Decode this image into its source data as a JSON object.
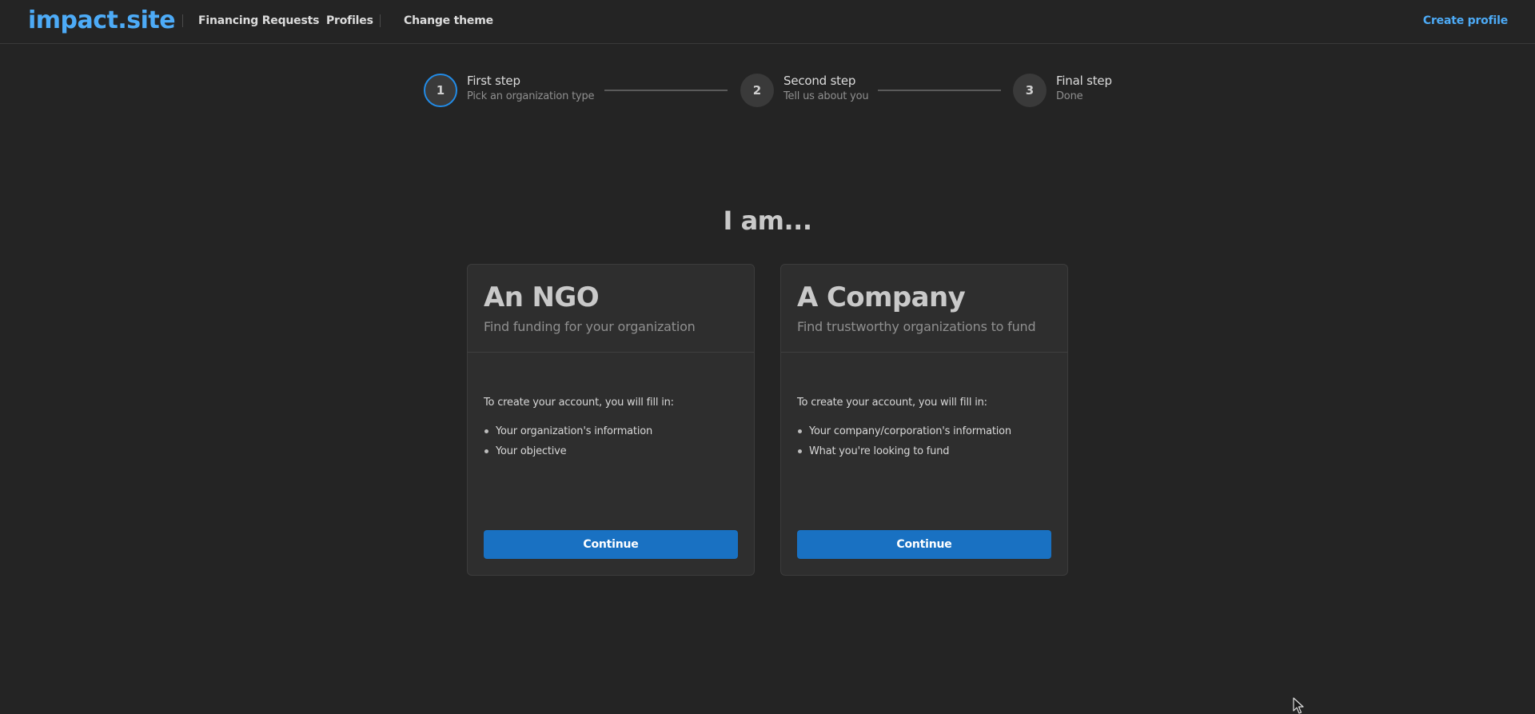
{
  "header": {
    "logo": "impact.site",
    "nav": [
      {
        "label": "Financing Requests"
      },
      {
        "label": "Profiles"
      },
      {
        "label": "Change theme"
      }
    ],
    "create_profile": "Create profile"
  },
  "stepper": {
    "steps": [
      {
        "number": "1",
        "title": "First step",
        "description": "Pick an organization type",
        "active": true
      },
      {
        "number": "2",
        "title": "Second step",
        "description": "Tell us about you",
        "active": false
      },
      {
        "number": "3",
        "title": "Final step",
        "description": "Done",
        "active": false
      }
    ]
  },
  "main": {
    "heading": "I am...",
    "cards": [
      {
        "title": "An NGO",
        "subtitle": "Find funding for your organization",
        "intro": "To create your account, you will fill in:",
        "items": [
          "Your organization's information",
          "Your objective"
        ],
        "button": "Continue"
      },
      {
        "title": "A Company",
        "subtitle": "Find trustworthy organizations to fund",
        "intro": "To create your account, you will fill in:",
        "items": [
          "Your company/corporation's information",
          "What you're looking to fund"
        ],
        "button": "Continue"
      }
    ]
  },
  "colors": {
    "background": "#242424",
    "accent": "#4dabf7",
    "button": "#1971c2",
    "card": "#2e2e2e"
  },
  "icons": {
    "cursor": "mouse-pointer-icon"
  }
}
